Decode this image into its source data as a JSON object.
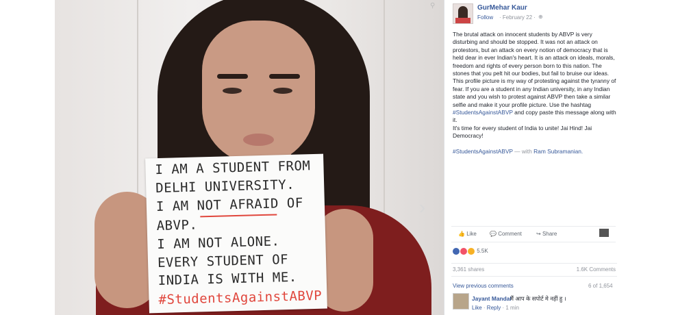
{
  "post": {
    "author": "GurMehar Kaur",
    "follow": "Follow",
    "date": "· February 22 ·",
    "body": [
      "The brutal attack on innocent students by ABVP is very disturbing and should be stopped. It was not an attack on protestors, but an attack on every notion of democracy that is held dear in ever Indian's heart. It is an attack on ideals, morals, freedom and rights of every person born to this nation. The stones that you pelt hit our bodies, but fail to bruise our ideas.",
      "This profile picture is my way of protesting against the tyranny of fear. If you are a student in any Indian university, in any Indian state and you wish to protest against ABVP then take a similar selfie and make it your profile picture. Use the hashtag"
    ],
    "hashtag_inline": "#StudentsAgainstABVP",
    "body_after_tag": "and copy paste this message along with it.",
    "body_end": "It's time for every student of India to unite! Jai Hind! Jai Democracy!",
    "footer_tag": "#StudentsAgainstABVP",
    "with_text": "— with",
    "with_name": "Ram Subramanian."
  },
  "actions": {
    "like": "Like",
    "comment": "Comment",
    "share": "Share"
  },
  "reactions": {
    "count": "5.5K",
    "colors": [
      "#4267b2",
      "#f25268",
      "#f7b125"
    ]
  },
  "stats": {
    "shares": "3,361 shares",
    "comments": "1.6K Comments"
  },
  "comments": {
    "view_previous": "View previous comments",
    "count": "6 of 1,654",
    "first": {
      "name": "Jayant Mandal",
      "text": "मैं आप के सपोर्ट मे नहीं हु ।",
      "like": "Like",
      "reply": "Reply",
      "time": "1 min"
    }
  },
  "sign": {
    "lines": [
      "I AM A STUDENT FROM",
      "DELHI UNIVERSITY.",
      "I AM NOT AFRAID OF",
      "ABVP.",
      "I AM NOT ALONE.",
      "EVERY STUDENT OF",
      "INDIA IS WITH ME."
    ],
    "tag": "#StudentsAgainstABVP"
  }
}
